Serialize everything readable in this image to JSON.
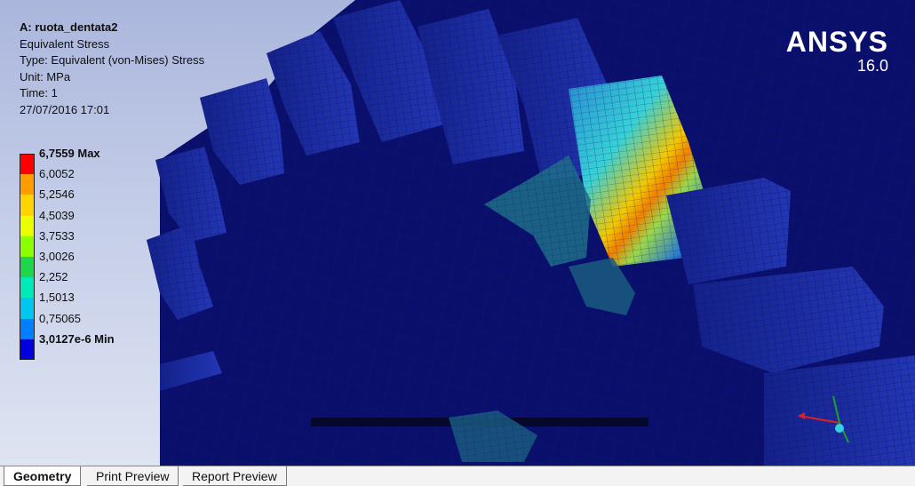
{
  "result": {
    "title": "A: ruota_dentata2",
    "quantity": "Equivalent Stress",
    "type": "Type: Equivalent (von-Mises) Stress",
    "unit": "Unit: MPa",
    "time": "Time: 1",
    "timestamp": "27/07/2016 17:01"
  },
  "legend": {
    "items": [
      {
        "label": "6,7559 Max",
        "color": "#ff0000",
        "bold": true
      },
      {
        "label": "6,0052",
        "color": "#ff9d00",
        "bold": false
      },
      {
        "label": "5,2546",
        "color": "#ffd400",
        "bold": false
      },
      {
        "label": "4,5039",
        "color": "#eaff00",
        "bold": false
      },
      {
        "label": "3,7533",
        "color": "#8cff00",
        "bold": false
      },
      {
        "label": "3,0026",
        "color": "#1ed64a",
        "bold": false
      },
      {
        "label": "2,252",
        "color": "#00e9b8",
        "bold": false
      },
      {
        "label": "1,5013",
        "color": "#00c6f0",
        "bold": false
      },
      {
        "label": "0,75065",
        "color": "#0080ff",
        "bold": false
      },
      {
        "label": "3,0127e-6 Min",
        "color": "#0000e0",
        "bold": true
      }
    ]
  },
  "brand": {
    "name": "ANSYS",
    "version": "16.0"
  },
  "colors": {
    "gear_face": "#0a0f6e",
    "gear_tooth": "#1d2ea6",
    "mesh_line": "#050830",
    "viewport_top": "#aab6dc"
  },
  "tabs": [
    {
      "label": "Geometry",
      "active": true
    },
    {
      "label": "Print Preview",
      "active": false
    },
    {
      "label": "Report Preview",
      "active": false
    }
  ]
}
